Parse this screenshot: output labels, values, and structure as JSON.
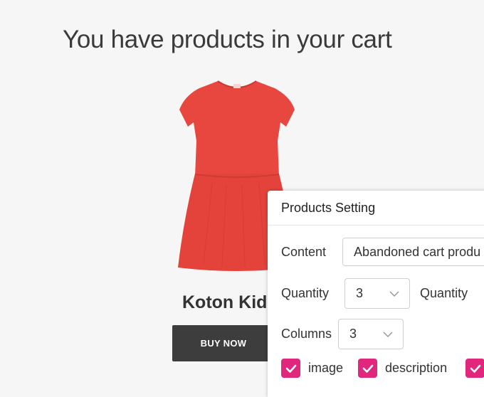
{
  "page": {
    "headline": "You have products in your cart"
  },
  "product": {
    "name": "Koton Kid",
    "buy_label": "BUY NOW",
    "image_icon": "red-dress-image"
  },
  "settings_panel": {
    "title": "Products Setting",
    "content_label": "Content",
    "content_value": "Abandoned cart produ",
    "quantity_label": "Quantity",
    "quantity_value": "3",
    "quantity_label_2": "Quantity",
    "columns_label": "Columns",
    "columns_value": "3",
    "checkboxes": [
      {
        "label": "image",
        "checked": true
      },
      {
        "label": "description",
        "checked": true
      },
      {
        "label": "",
        "checked": true
      }
    ]
  },
  "colors": {
    "accent": "#e0267d",
    "button_bg": "#3d3d3d",
    "dress_red": "#e8473f"
  }
}
